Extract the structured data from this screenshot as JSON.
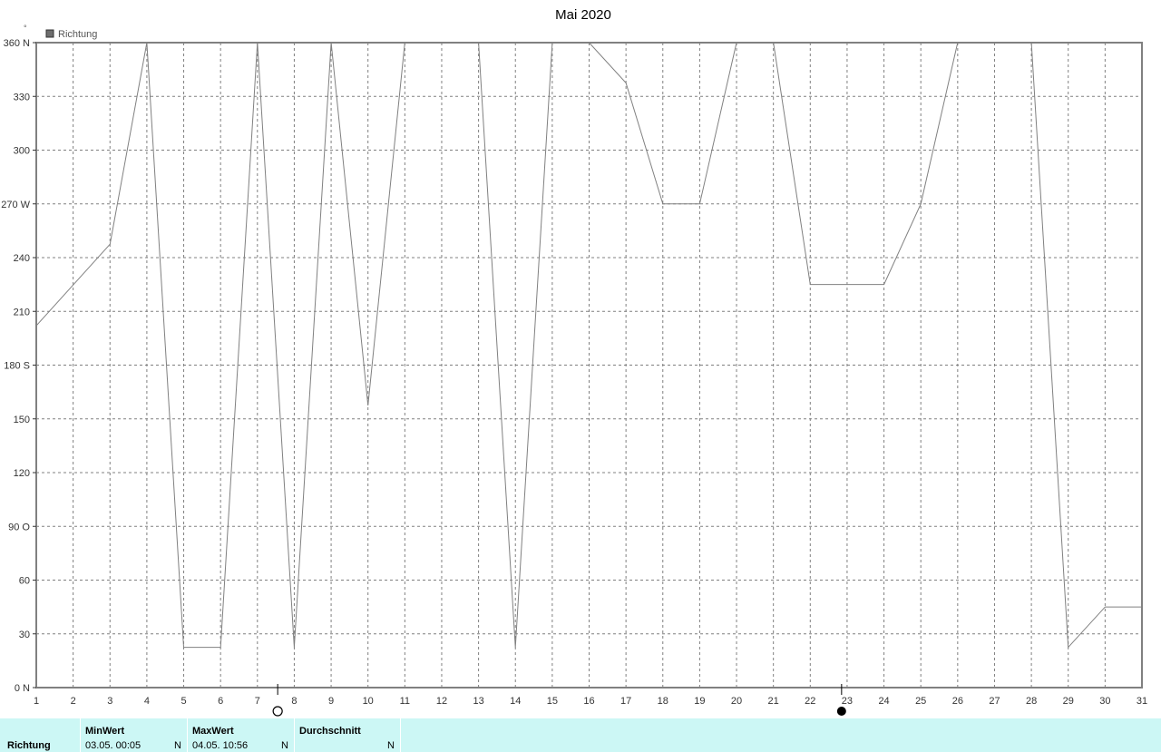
{
  "chart_data": {
    "type": "line",
    "title": "Mai 2020",
    "legend": [
      "Richtung"
    ],
    "legend_position": "top-left",
    "unit_symbol": "°",
    "grid": true,
    "x_ticks": [
      "1",
      "2",
      "3",
      "4",
      "5",
      "6",
      "7",
      "8",
      "9",
      "10",
      "11",
      "12",
      "13",
      "14",
      "15",
      "16",
      "17",
      "18",
      "19",
      "20",
      "21",
      "22",
      "23",
      "24",
      "25",
      "26",
      "27",
      "28",
      "29",
      "30",
      "31"
    ],
    "xlim": [
      1,
      31
    ],
    "ylim": [
      0,
      360
    ],
    "y_ticks": [
      {
        "value": 0,
        "label": "0",
        "dir": "N"
      },
      {
        "value": 30,
        "label": "30",
        "dir": ""
      },
      {
        "value": 60,
        "label": "60",
        "dir": ""
      },
      {
        "value": 90,
        "label": "90",
        "dir": "O"
      },
      {
        "value": 120,
        "label": "120",
        "dir": ""
      },
      {
        "value": 150,
        "label": "150",
        "dir": ""
      },
      {
        "value": 180,
        "label": "180",
        "dir": "S"
      },
      {
        "value": 210,
        "label": "210",
        "dir": ""
      },
      {
        "value": 240,
        "label": "240",
        "dir": ""
      },
      {
        "value": 270,
        "label": "270",
        "dir": "W"
      },
      {
        "value": 300,
        "label": "300",
        "dir": ""
      },
      {
        "value": 330,
        "label": "330",
        "dir": ""
      },
      {
        "value": 360,
        "label": "360",
        "dir": "N"
      }
    ],
    "series": [
      {
        "name": "Richtung",
        "color": "#808080",
        "points": [
          [
            1,
            202
          ],
          [
            3,
            247.5
          ],
          [
            4,
            360
          ],
          [
            5,
            22.5
          ],
          [
            6,
            22.5
          ],
          [
            7,
            360
          ],
          [
            8,
            22.5
          ],
          [
            9,
            360
          ],
          [
            10,
            157.5
          ],
          [
            11,
            360
          ],
          [
            13,
            360
          ],
          [
            14,
            22.5
          ],
          [
            15,
            360
          ],
          [
            16,
            360
          ],
          [
            17,
            337.5
          ],
          [
            18,
            270
          ],
          [
            19,
            270
          ],
          [
            20,
            360
          ],
          [
            21,
            360
          ],
          [
            22,
            225
          ],
          [
            23,
            225
          ],
          [
            24,
            225
          ],
          [
            25,
            270
          ],
          [
            26,
            360
          ],
          [
            28,
            360
          ],
          [
            29,
            22.5
          ],
          [
            30,
            45
          ],
          [
            31,
            45
          ]
        ]
      }
    ],
    "moon_phases": [
      {
        "phase": "full",
        "x": 7.55
      },
      {
        "phase": "new",
        "x": 22.85
      }
    ]
  },
  "stats": {
    "row_label": "Richtung",
    "min": {
      "header": "MinWert",
      "value": "03.05.  00:05",
      "unit": "N"
    },
    "max": {
      "header": "MaxWert",
      "value": "04.05.  10:56",
      "unit": "N"
    },
    "avg": {
      "header": "Durchschnitt",
      "value": "",
      "unit": "N"
    }
  },
  "colors": {
    "stats_background": "#ccf7f5",
    "line": "#808080",
    "grid": "#808080",
    "legend_swatch": "#6e6e6e"
  }
}
